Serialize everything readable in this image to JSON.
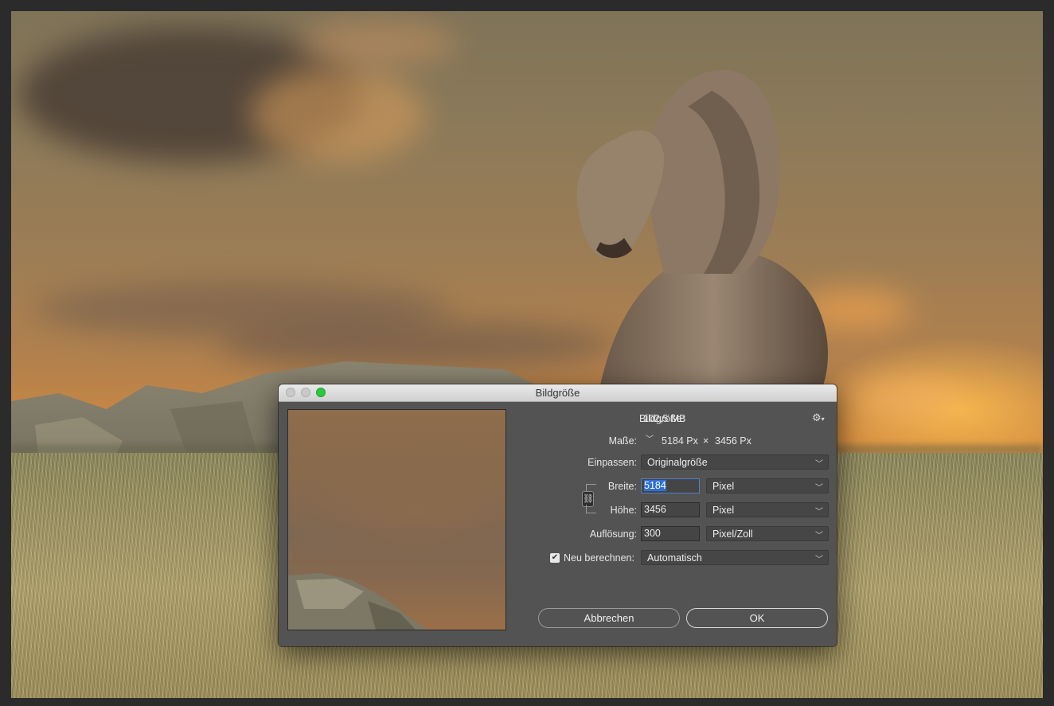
{
  "dialog": {
    "title": "Bildgröße",
    "image_size_label": "Bildgröße:",
    "image_size_value": "102,5 MB",
    "dimensions_label": "Maße:",
    "dimensions_width": "5184 Px",
    "dimensions_times": "×",
    "dimensions_height": "3456 Px",
    "fit_label": "Einpassen:",
    "fit_value": "Originalgröße",
    "width_label": "Breite:",
    "width_value": "5184",
    "width_unit": "Pixel",
    "height_label": "Höhe:",
    "height_value": "3456",
    "height_unit": "Pixel",
    "resolution_label": "Auflösung:",
    "resolution_value": "300",
    "resolution_unit": "Pixel/Zoll",
    "resample_label": "Neu berechnen:",
    "resample_checked": true,
    "resample_value": "Automatisch",
    "cancel_label": "Abbrechen",
    "ok_label": "OK"
  },
  "icons": {
    "settings": "gear-icon",
    "link": "chain-link-icon",
    "dimensions_dropdown": "chevron-down-icon",
    "select_arrow": "chevron-down-icon"
  },
  "colors": {
    "dialog_bg": "#535353",
    "field_bg": "#454545",
    "selection_blue": "#2f6fd6",
    "close_light": "#c9c9c9",
    "zoom_light": "#2ac940"
  }
}
